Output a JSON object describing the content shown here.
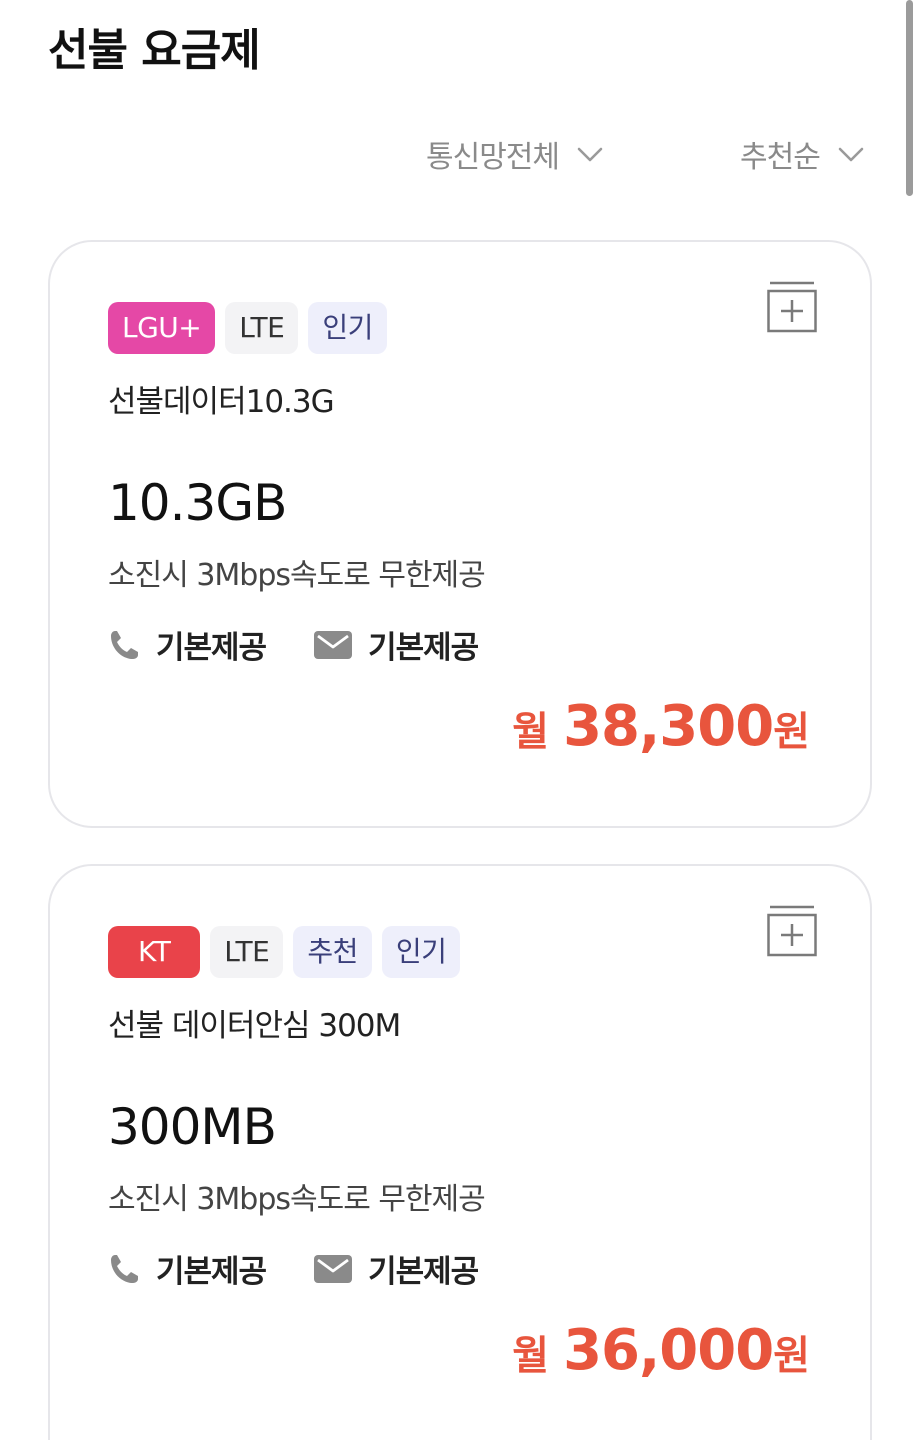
{
  "page": {
    "title": "선불 요금제"
  },
  "filters": {
    "network": {
      "label": "통신망전체",
      "icon": "chevron-down-icon"
    },
    "sort": {
      "label": "추천순",
      "icon": "chevron-down-icon"
    }
  },
  "colors": {
    "price": "#e8553d",
    "lgu": "#e548a6",
    "kt": "#e9434a",
    "tag_bg": "#eeeffb",
    "type_bg": "#f3f3f5"
  },
  "plans": [
    {
      "carrier": "LGU+",
      "network_type": "LTE",
      "tags": [
        "인기"
      ],
      "name": "선불데이터10.3G",
      "data": "10.3GB",
      "data_desc": "소진시 3Mbps속도로 무한제공",
      "call": "기본제공",
      "sms": "기본제공",
      "price_prefix": "월",
      "price": "38,300",
      "price_unit": "원"
    },
    {
      "carrier": "KT",
      "network_type": "LTE",
      "tags": [
        "추천",
        "인기"
      ],
      "name": "선불 데이터안심 300M",
      "data": "300MB",
      "data_desc": "소진시 3Mbps속도로 무한제공",
      "call": "기본제공",
      "sms": "기본제공",
      "price_prefix": "월",
      "price": "36,000",
      "price_unit": "원"
    }
  ]
}
